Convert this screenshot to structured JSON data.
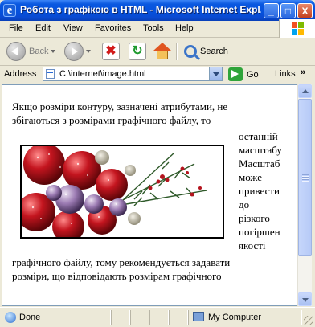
{
  "window": {
    "title": "Робота з графікою в HTML - Microsoft Internet Expl...",
    "app_icon": "e",
    "minimize": "_",
    "maximize": "□",
    "close": "X"
  },
  "menu": [
    "File",
    "Edit",
    "View",
    "Favorites",
    "Tools",
    "Help"
  ],
  "toolbar": {
    "back_label": "Back",
    "search_label": "Search"
  },
  "address": {
    "label": "Address",
    "value": "C:\\internet\\image.html",
    "go_label": "Go",
    "links_label": "Links",
    "links_chevron": "»"
  },
  "content": {
    "lines": [
      "Якщо розміри контуру, зазначені атрибутами, не",
      "збігаються з розмірами графічного файлу, то",
      "останній",
      "масштабу",
      "Масштаб",
      "може",
      "привести",
      "до",
      "різкого",
      "погіршен",
      "якості",
      "графічного файлу, тому рекомендується задавати",
      "розміри, що відповідають розмірам графічного"
    ],
    "image_alt": "фото: ялинкові прикраси та ягоди"
  },
  "status": {
    "text": "Done",
    "zone": "My Computer"
  },
  "colors": {
    "titlebar": "#0550dc",
    "chrome": "#ece9d8",
    "berry_red": "#b3121f",
    "frost_purple": "#8e6aa3"
  },
  "icons": [
    "ie-icon",
    "back-icon",
    "forward-icon",
    "stop-icon",
    "refresh-icon",
    "home-icon",
    "search-icon",
    "page-icon",
    "go-icon",
    "globe-icon",
    "computer-icon"
  ]
}
